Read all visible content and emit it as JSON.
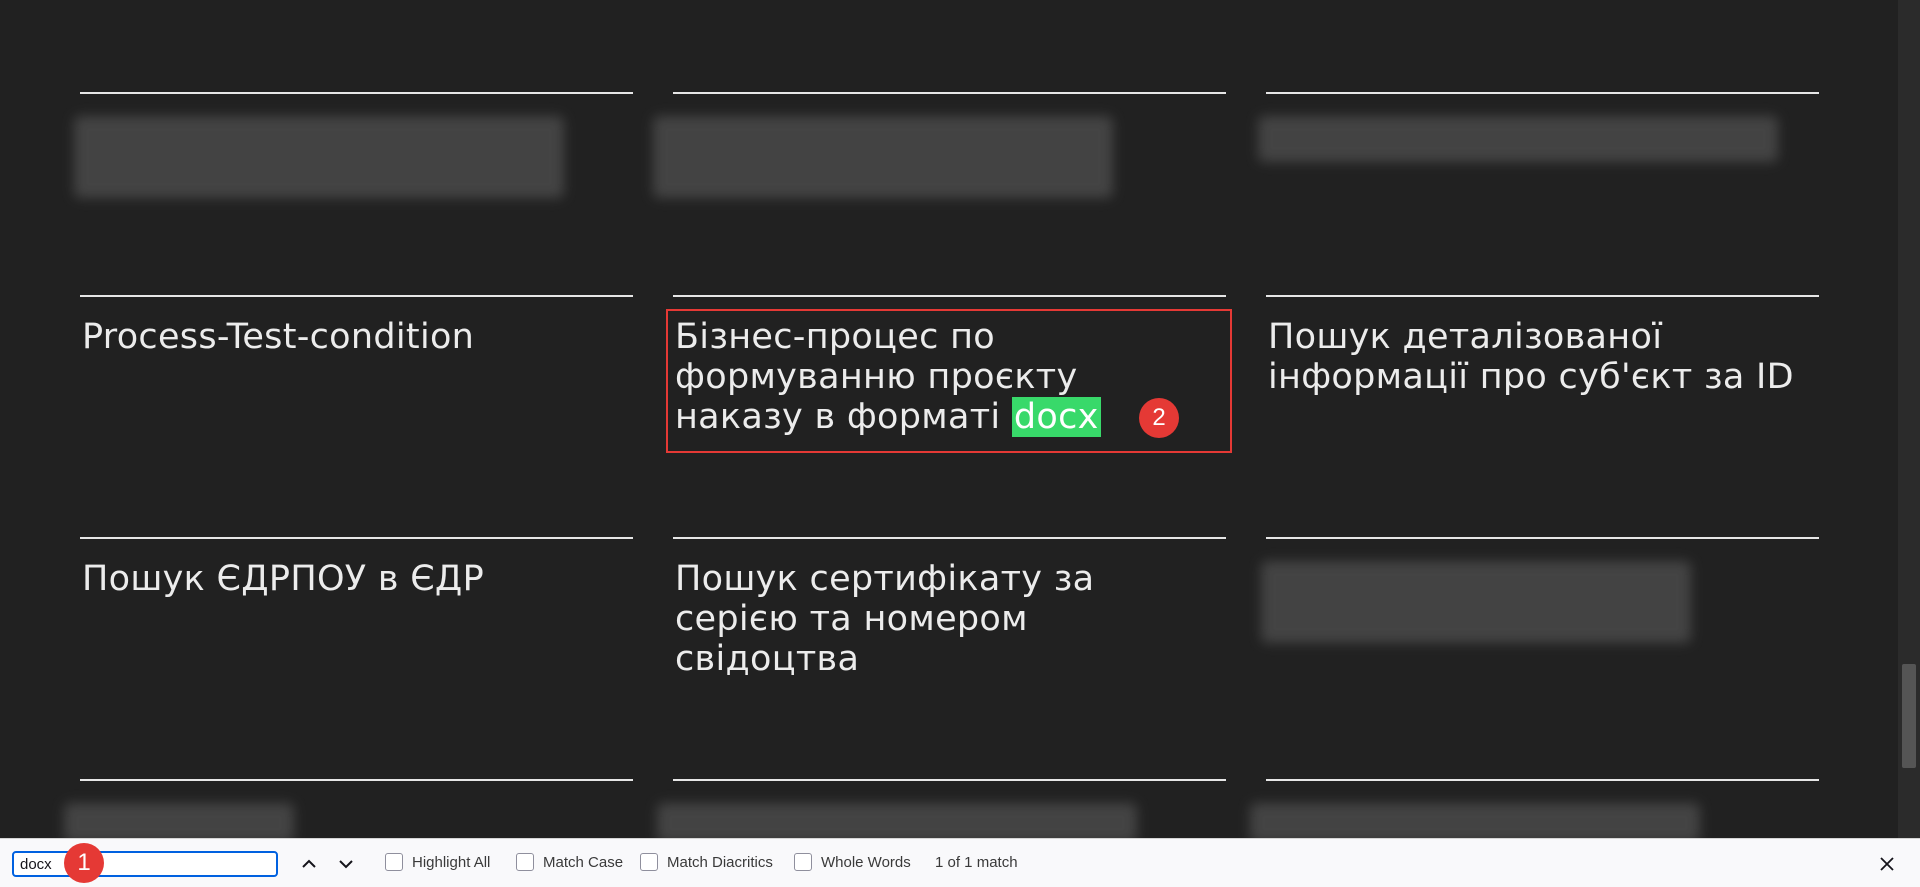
{
  "cards": [
    {
      "title": ""
    },
    {
      "title": ""
    },
    {
      "title": ""
    },
    {
      "title": "Process-Test-condition"
    },
    {
      "title_before": "Бізнес-процес по формуванню проєкту наказу в форматі ",
      "title_match": "docx"
    },
    {
      "title": "Пошук деталізованої інформації про суб'єкт за ID"
    },
    {
      "title": "Пошук ЄДРПОУ в ЄДР"
    },
    {
      "title": "Пошук сертифікату за серією та номером свідоцтва"
    }
  ],
  "annotations": {
    "badge_1": "1",
    "badge_2": "2"
  },
  "findbar": {
    "query": "docx",
    "highlight_all": "Highlight All",
    "match_case": "Match Case",
    "match_diacritics": "Match Diacritics",
    "whole_words": "Whole Words",
    "match_count": "1 of 1 match"
  },
  "colors": {
    "background": "#212121",
    "match_highlight": "#38d96a",
    "annotation": "#e53935",
    "input_focus": "#0061e0"
  },
  "icons": [
    "chevron-up-icon",
    "chevron-down-icon",
    "close-icon"
  ]
}
